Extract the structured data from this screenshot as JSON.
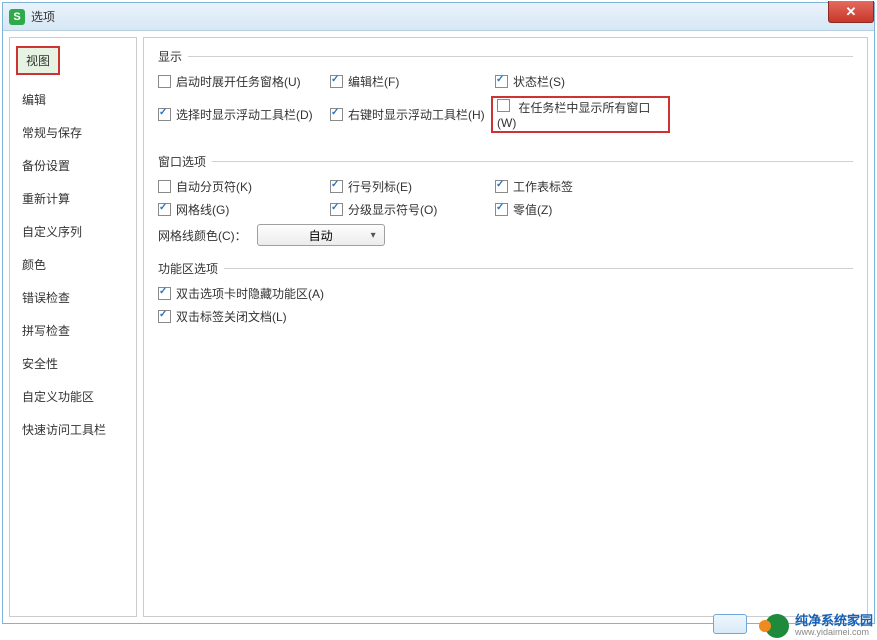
{
  "window": {
    "title": "选项"
  },
  "sidebar": {
    "items": [
      "视图",
      "编辑",
      "常规与保存",
      "备份设置",
      "重新计算",
      "自定义序列",
      "颜色",
      "错误检查",
      "拼写检查",
      "安全性",
      "自定义功能区",
      "快速访问工具栏"
    ],
    "active_index": 0
  },
  "sections": {
    "display": {
      "legend": "显示",
      "items": {
        "startup_taskpane": {
          "label": "启动时展开任务窗格(U)",
          "checked": false
        },
        "edit_bar": {
          "label": "编辑栏(F)",
          "checked": true
        },
        "status_bar": {
          "label": "状态栏(S)",
          "checked": true
        },
        "float_toolbar_select": {
          "label": "选择时显示浮动工具栏(D)",
          "checked": true
        },
        "float_toolbar_rclick": {
          "label": "右键时显示浮动工具栏(H)",
          "checked": true
        },
        "taskbar_all_windows": {
          "label": "在任务栏中显示所有窗口(W)",
          "checked": false
        }
      }
    },
    "window_opts": {
      "legend": "窗口选项",
      "items": {
        "auto_pagebreak": {
          "label": "自动分页符(K)",
          "checked": false
        },
        "row_col_header": {
          "label": "行号列标(E)",
          "checked": true
        },
        "sheet_tabs": {
          "label": "工作表标签",
          "checked": true
        },
        "gridlines": {
          "label": "网格线(G)",
          "checked": true
        },
        "outline_symbols": {
          "label": "分级显示符号(O)",
          "checked": true
        },
        "zero_values": {
          "label": "零值(Z)",
          "checked": true
        }
      },
      "grid_color_label": "网格线颜色(C)：",
      "grid_color_value": "自动"
    },
    "ribbon_opts": {
      "legend": "功能区选项",
      "items": {
        "dblclick_hide_ribbon": {
          "label": "双击选项卡时隐藏功能区(A)",
          "checked": true
        },
        "dblclick_close_doc": {
          "label": "双击标签关闭文档(L)",
          "checked": true
        }
      }
    }
  },
  "watermark": {
    "cn": "纯净系统家园",
    "url": "www.yidaimei.com"
  }
}
